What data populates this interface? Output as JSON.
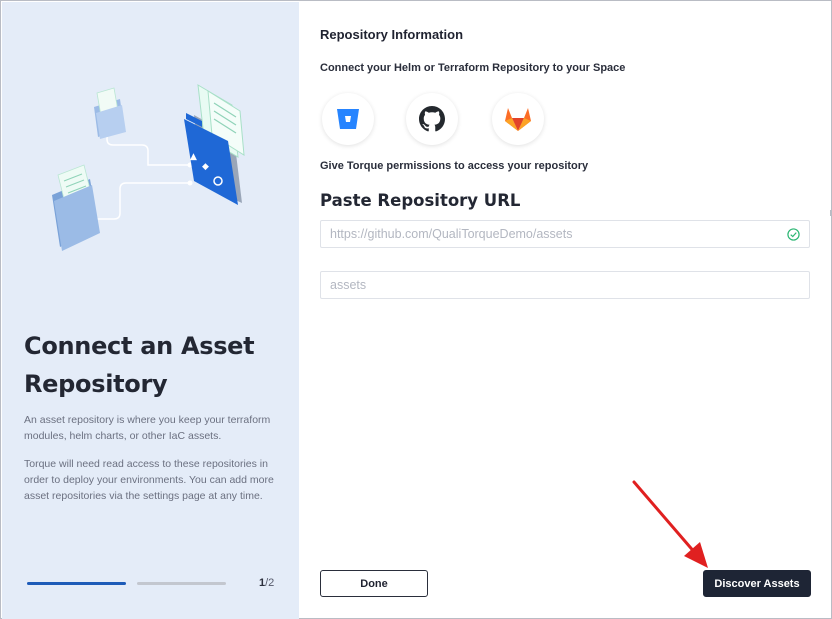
{
  "left": {
    "title": "Connect an Asset Repository",
    "description_1": "An asset repository is where you keep your terraform modules, helm charts, or other IaC assets.",
    "description_2": "Torque will need read access to these repositories in order to deploy your environments. You can add more asset repositories via the settings page at any time.",
    "step_current": "1",
    "step_total": "/2",
    "progress": {
      "current": 1,
      "total": 2
    }
  },
  "main": {
    "section_title": "Repository Information",
    "connect_label": "Connect your Helm or Terraform Repository to your Space",
    "providers": [
      {
        "name": "bitbucket-icon",
        "color": "#2684ff"
      },
      {
        "name": "github-icon",
        "color": "#24292e"
      },
      {
        "name": "gitlab-icon",
        "color": "#fc6d26"
      }
    ],
    "permissions_label": "Give Torque permissions to access your repository",
    "paste_title": "Paste Repository URL",
    "url_field": {
      "placeholder": "https://github.com/QualiTorqueDemo/assets",
      "valid": true
    },
    "name_field": {
      "placeholder": "assets"
    }
  },
  "footer": {
    "done_label": "Done",
    "discover_label": "Discover Assets"
  },
  "colors": {
    "panel_bg": "#e4ecf8",
    "accent_blue": "#1d5bb8",
    "primary_button": "#1e2535",
    "annotation_arrow": "#e02020",
    "valid_check": "#2bb673"
  }
}
